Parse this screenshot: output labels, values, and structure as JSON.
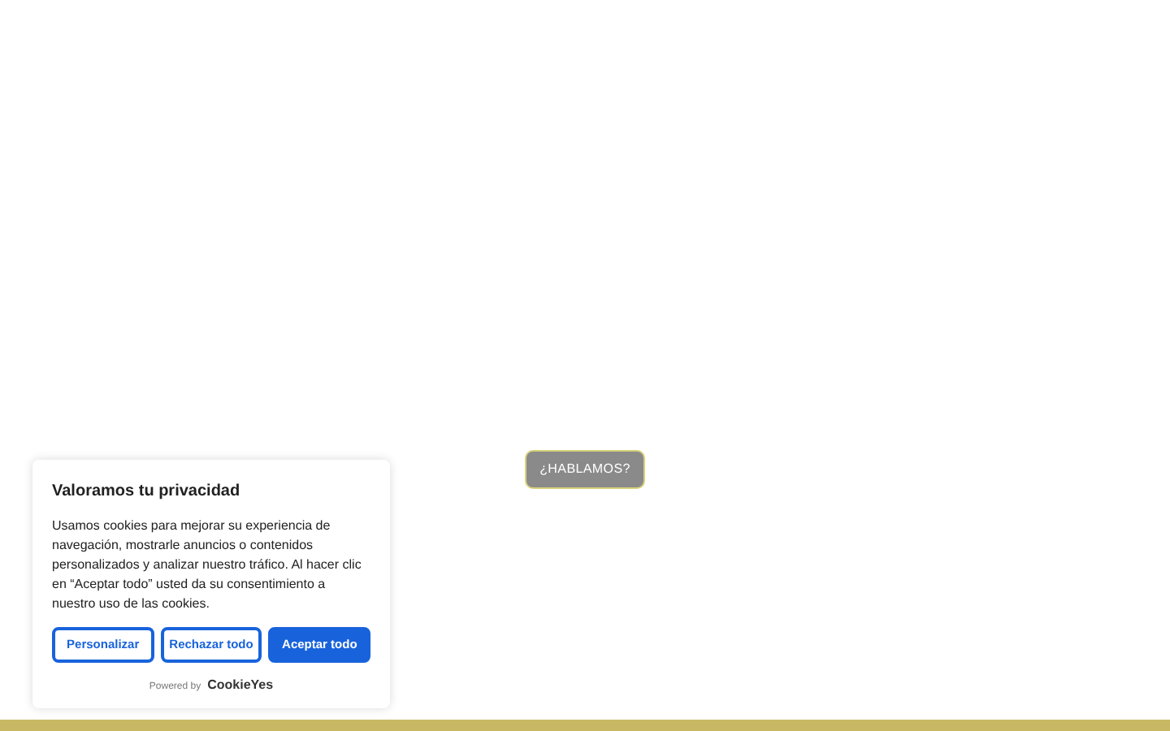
{
  "chat_button": {
    "label": "¿HABLAMOS?"
  },
  "cookie_banner": {
    "title": "Valoramos tu privacidad",
    "text": "Usamos cookies para mejorar su experiencia de navegación, mostrarle anuncios o contenidos personalizados y analizar nuestro tráfico. Al hacer clic en “Aceptar todo” usted da su consentimiento a nuestro uso de las cookies.",
    "buttons": [
      {
        "label": "Personalizar",
        "kind": "outline"
      },
      {
        "label": "Rechazar todo",
        "kind": "outline"
      },
      {
        "label": "Aceptar todo",
        "kind": "primary"
      }
    ],
    "powered_by": "Powered by",
    "brand": "CookieYes"
  }
}
